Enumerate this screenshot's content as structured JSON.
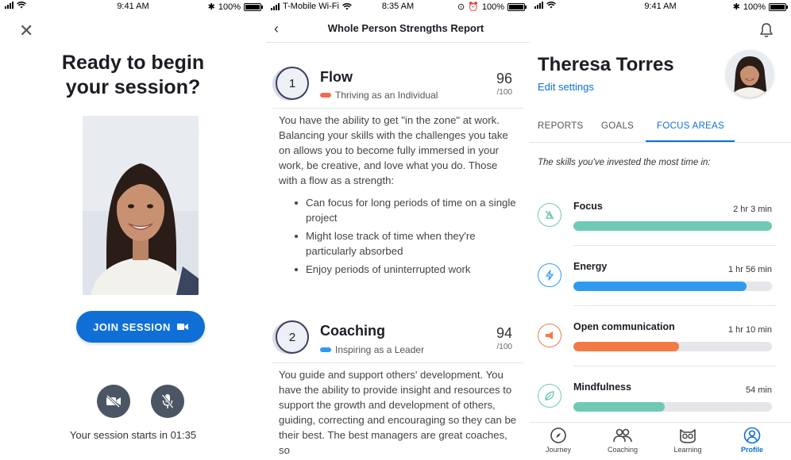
{
  "screen1": {
    "status": {
      "time": "9:41 AM",
      "battery": "100%"
    },
    "title_line1": "Ready to begin",
    "title_line2": "your session?",
    "join_label": "JOIN SESSION",
    "starts_text": "Your session starts in 01:35",
    "icons": [
      "close-icon",
      "video-camera-icon",
      "video-off-icon",
      "mic-off-icon"
    ]
  },
  "screen2": {
    "status": {
      "carrier": "T-Mobile Wi-Fi",
      "time": "8:35 AM",
      "battery": "100%"
    },
    "header_title": "Whole Person Strengths Report",
    "strengths": [
      {
        "number": "1",
        "name": "Flow",
        "subtitle": "Thriving as an Individual",
        "pill_color": "#f26b4f",
        "score": "96",
        "score_of": "/100",
        "description": "You have the ability to get \"in the zone\" at work. Balancing your skills with the challenges you take on allows you to become fully immersed in your work, be creative, and love what you do. Those with a flow as a strength:",
        "bullets": [
          "Can focus for long periods of time on a single project",
          "Might lose track of time when they're particularly absorbed",
          "Enjoy periods of uninterrupted work"
        ]
      },
      {
        "number": "2",
        "name": "Coaching",
        "subtitle": "Inspiring as a Leader",
        "pill_color": "#2e9bf0",
        "score": "94",
        "score_of": "/100",
        "description": "You guide and support others' development. You have the ability to provide insight and resources to support the growth and development of others, guiding, correcting and encouraging so they can be their best. The best managers are great coaches, so"
      }
    ]
  },
  "screen3": {
    "status": {
      "time": "9:41 AM",
      "battery": "100%"
    },
    "user_name": "Theresa Torres",
    "edit_settings": "Edit settings",
    "tabs": [
      "REPORTS",
      "GOALS",
      "FOCUS AREAS"
    ],
    "active_tab": "FOCUS AREAS",
    "skills_intro": "The skills you've invested the most time in:",
    "focus_areas": [
      {
        "name": "Focus",
        "time": "2 hr 3 min",
        "fraction": 1.0,
        "color": "#6fc9b5",
        "icon": "focus-off-icon"
      },
      {
        "name": "Energy",
        "time": "1 hr 56 min",
        "fraction": 0.87,
        "color": "#2e9bf0",
        "icon": "lightning-icon"
      },
      {
        "name": "Open communication",
        "time": "1 hr 10 min",
        "fraction": 0.53,
        "color": "#f47a45",
        "icon": "megaphone-icon"
      },
      {
        "name": "Mindfulness",
        "time": "54 min",
        "fraction": 0.46,
        "color": "#6fc9b5",
        "icon": "leaf-icon"
      }
    ],
    "tabbar": [
      {
        "label": "Journey",
        "icon": "compass-icon"
      },
      {
        "label": "Coaching",
        "icon": "people-icon"
      },
      {
        "label": "Learning",
        "icon": "owl-icon"
      },
      {
        "label": "Profile",
        "icon": "profile-icon",
        "active": true
      }
    ]
  },
  "colors": {
    "accent": "#0f6fd6",
    "dark_text": "#1c1c24"
  }
}
